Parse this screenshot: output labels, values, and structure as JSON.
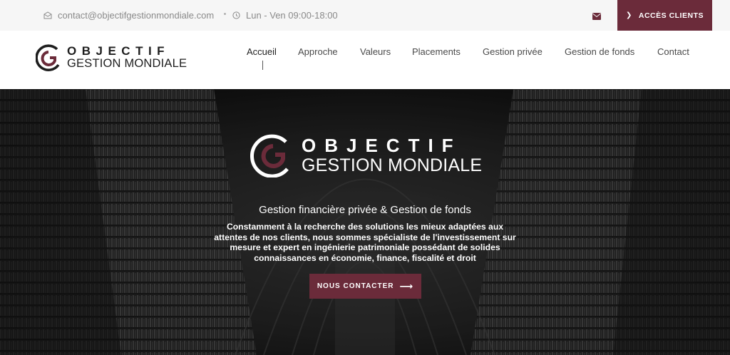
{
  "topbar": {
    "email": "contact@objectifgestionmondiale.com",
    "hours": "Lun - Ven 09:00-18:00",
    "access_label": "ACCÈS CLIENTS"
  },
  "logo": {
    "line1": "OBJECTIF",
    "line2": "GESTION MONDIALE"
  },
  "nav": {
    "items": [
      {
        "label": "Accueil"
      },
      {
        "label": "Approche"
      },
      {
        "label": "Valeurs"
      },
      {
        "label": "Placements"
      },
      {
        "label": "Gestion privée"
      },
      {
        "label": "Gestion de fonds"
      },
      {
        "label": "Contact"
      }
    ]
  },
  "hero": {
    "logo_line1": "OBJECTIF",
    "logo_line2": "GESTION MONDIALE",
    "subtitle": "Gestion financière privée & Gestion de fonds",
    "desc_lines": [
      "Constamment à la recherche des solutions les mieux adaptées aux",
      "attentes de nos clients, nous sommes spécialiste de l'investissement sur",
      "mesure et expert en ingénierie patrimoniale possédant de solides",
      "connaissances en économie, finance, fiscalité et droit"
    ],
    "cta_label": "NOUS CONTACTER"
  },
  "colors": {
    "brand": "#6b2b3a",
    "icons": [
      "envelope-icon",
      "clock-icon",
      "chevron-right-icon",
      "arrow-right-icon"
    ]
  }
}
